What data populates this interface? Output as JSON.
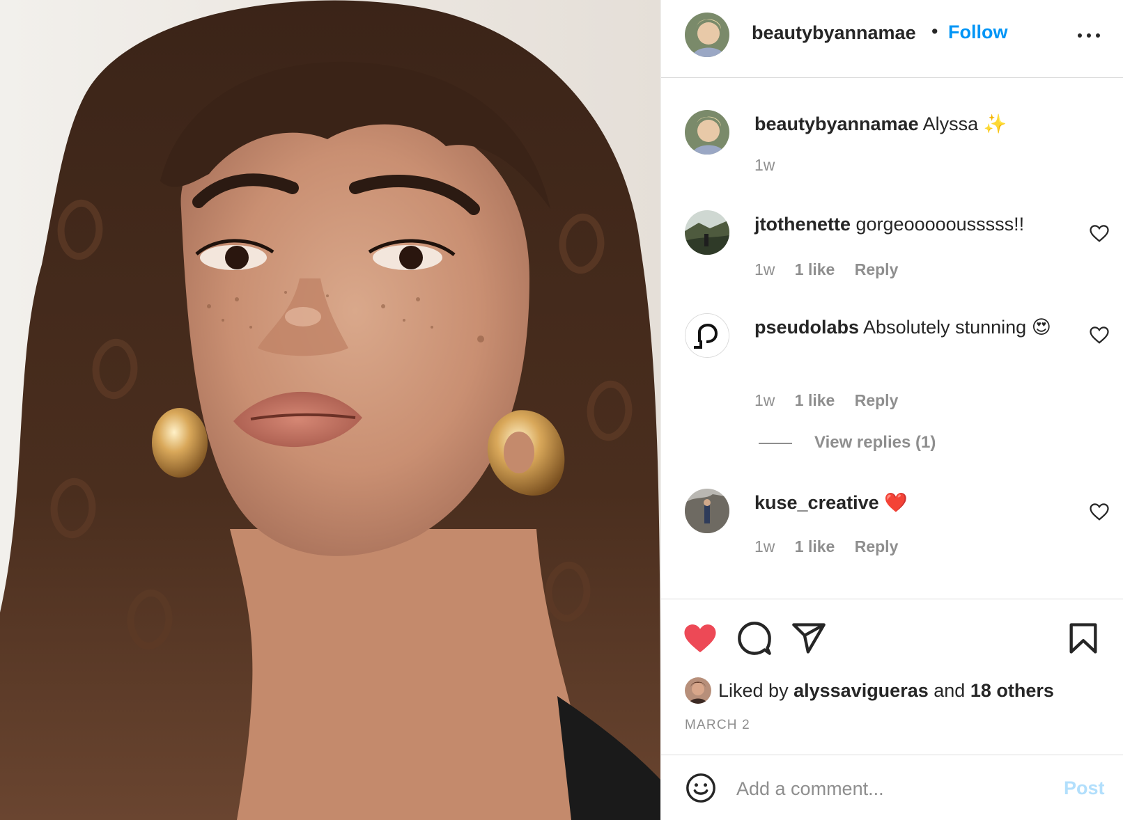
{
  "post": {
    "author": "beautybyannamae",
    "follow_label": "Follow",
    "separator": "•",
    "more_icon": "more-horizontal-icon"
  },
  "caption": {
    "user": "beautybyannamae",
    "text": "Alyssa ✨",
    "time": "1w"
  },
  "comments": [
    {
      "user": "jtothenette",
      "text": "gorgeooooousssss!!",
      "time": "1w",
      "likes": "1 like",
      "reply": "Reply"
    },
    {
      "user": "pseudolabs",
      "text": "Absolutely stunning 😍",
      "time": "1w",
      "likes": "1 like",
      "reply": "Reply",
      "view_replies": "View replies (1)"
    },
    {
      "user": "kuse_creative",
      "text": "❤️",
      "time": "1w",
      "likes": "1 like",
      "reply": "Reply"
    }
  ],
  "actions": {
    "like_icon": "heart-filled-icon",
    "comment_icon": "comment-icon",
    "share_icon": "share-icon",
    "save_icon": "bookmark-icon",
    "like_color": "#ed4956"
  },
  "likes": {
    "prefix": "Liked by",
    "user": "alyssavigueras",
    "middle": "and",
    "others": "18 others"
  },
  "date": "MARCH 2",
  "composer": {
    "placeholder": "Add a comment...",
    "post_label": "Post",
    "post_color": "#b2dffc"
  },
  "colors": {
    "link": "#0095f6",
    "muted": "#8e8e8e",
    "text": "#262626"
  }
}
